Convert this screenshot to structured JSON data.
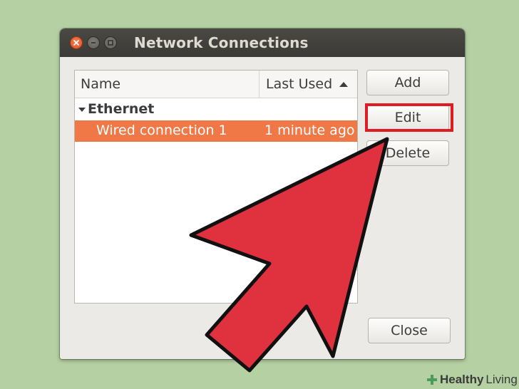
{
  "window": {
    "title": "Network Connections"
  },
  "list": {
    "columns": [
      {
        "label": "Name"
      },
      {
        "label": "Last Used",
        "sort": "ascending"
      }
    ],
    "groups": [
      {
        "label": "Ethernet",
        "expanded": true,
        "connections": [
          {
            "name": "Wired connection 1",
            "last_used": "1 minute ago",
            "selected": true
          }
        ]
      }
    ]
  },
  "buttons": {
    "add": "Add",
    "edit": "Edit",
    "delete": "Delete",
    "close": "Close"
  },
  "annotation": {
    "highlighted_button": "edit",
    "highlight_color": "#e01b24",
    "arrow_color": "#e0313f"
  },
  "watermark": {
    "bold": "Healthy",
    "regular": "Living"
  },
  "colors": {
    "background": "#b5d1a3",
    "selection": "#f07746",
    "titlebar": "#3c3b37"
  }
}
